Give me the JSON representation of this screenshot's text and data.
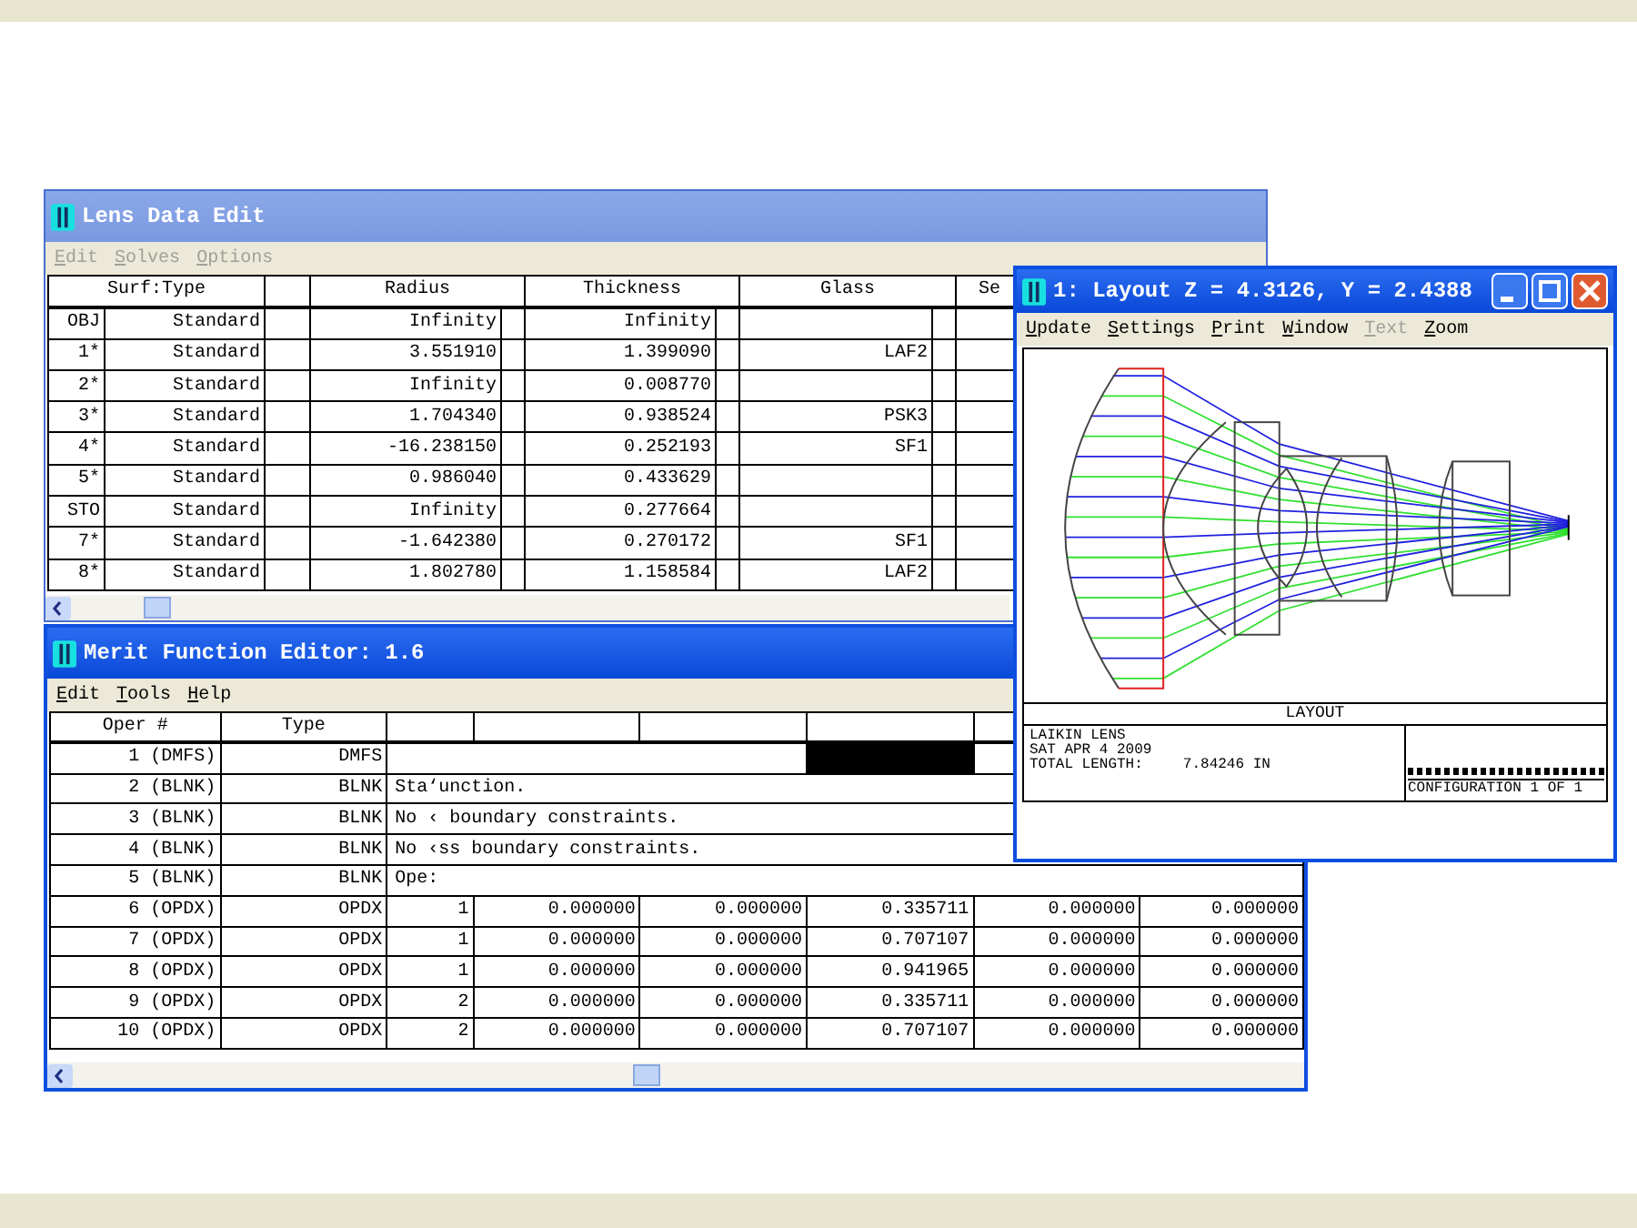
{
  "lens_window": {
    "title": "Lens Data Edit",
    "active": false,
    "menu": [
      {
        "label": "Edit",
        "disabled": true
      },
      {
        "label": "Solves",
        "disabled": true
      },
      {
        "label": "Options",
        "disabled": true
      }
    ],
    "columns": [
      "Surf:Type",
      "Radius",
      "Thickness",
      "Glass",
      "Se"
    ],
    "rows": [
      {
        "surf": "OBJ",
        "type": "Standard",
        "radius": "Infinity",
        "thickness": "Infinity"
      },
      {
        "surf": "1*",
        "type": "Standard",
        "radius": "3.551910",
        "thickness": "1.399090",
        "glass": "LAF2"
      },
      {
        "surf": "2*",
        "type": "Standard",
        "radius": "Infinity",
        "thickness": "0.008770"
      },
      {
        "surf": "3*",
        "type": "Standard",
        "radius": "1.704340",
        "thickness": "0.938524",
        "glass": "PSK3"
      },
      {
        "surf": "4*",
        "type": "Standard",
        "radius": "-16.238150",
        "thickness": "0.252193",
        "glass": "SF1"
      },
      {
        "surf": "5*",
        "type": "Standard",
        "radius": "0.986040",
        "thickness": "0.433629"
      },
      {
        "surf": "STO",
        "type": "Standard",
        "radius": "Infinity",
        "thickness": "0.277664"
      },
      {
        "surf": "7*",
        "type": "Standard",
        "radius": "-1.642380",
        "thickness": "0.270172",
        "glass": "SF1"
      },
      {
        "surf": "8*",
        "type": "Standard",
        "radius": "1.802780",
        "thickness": "1.158584",
        "glass": "LAF2"
      }
    ]
  },
  "merit_window": {
    "title": "Merit Function Editor: 1.6",
    "active": true,
    "menu": [
      {
        "label": "Edit",
        "disabled": false
      },
      {
        "label": "Tools",
        "disabled": false
      },
      {
        "label": "Help",
        "disabled": false
      }
    ],
    "columns": [
      "Oper #",
      "Type"
    ],
    "rows": [
      {
        "kind": "target",
        "oper": "1 (DMFS)",
        "type": "DMFS"
      },
      {
        "kind": "comment",
        "oper": "2 (BLNK)",
        "type": "BLNK",
        "comment": "Sta‘unction."
      },
      {
        "kind": "comment",
        "oper": "3 (BLNK)",
        "type": "BLNK",
        "comment": "No ‹ boundary constraints."
      },
      {
        "kind": "comment",
        "oper": "4 (BLNK)",
        "type": "BLNK",
        "comment": "No ‹ss boundary constraints."
      },
      {
        "kind": "comment",
        "oper": "5 (BLNK)",
        "type": "BLNK",
        "comment": "Ope:"
      },
      {
        "kind": "operand",
        "oper": "6 (OPDX)",
        "type": "OPDX",
        "cells": [
          "1",
          "0.000000",
          "0.000000",
          "0.335711",
          "0.000000",
          "0.000000"
        ]
      },
      {
        "kind": "operand",
        "oper": "7 (OPDX)",
        "type": "OPDX",
        "cells": [
          "1",
          "0.000000",
          "0.000000",
          "0.707107",
          "0.000000",
          "0.000000"
        ]
      },
      {
        "kind": "operand",
        "oper": "8 (OPDX)",
        "type": "OPDX",
        "cells": [
          "1",
          "0.000000",
          "0.000000",
          "0.941965",
          "0.000000",
          "0.000000"
        ]
      },
      {
        "kind": "operand",
        "oper": "9 (OPDX)",
        "type": "OPDX",
        "cells": [
          "2",
          "0.000000",
          "0.000000",
          "0.335711",
          "0.000000",
          "0.000000"
        ]
      },
      {
        "kind": "operand",
        "oper": "10 (OPDX)",
        "type": "OPDX",
        "cells": [
          "2",
          "0.000000",
          "0.000000",
          "0.707107",
          "0.000000",
          "0.000000"
        ]
      }
    ]
  },
  "layout_window": {
    "title": "1: Layout Z = 4.3126, Y = 2.4388",
    "active": true,
    "menu": [
      {
        "label": "Update",
        "disabled": false
      },
      {
        "label": "Settings",
        "disabled": false
      },
      {
        "label": "Print",
        "disabled": false
      },
      {
        "label": "Window",
        "disabled": false
      },
      {
        "label": "Text",
        "disabled": true
      },
      {
        "label": "Zoom",
        "disabled": false
      }
    ],
    "plot_title": "LAYOUT",
    "lens_name": "LAIKIN LENS",
    "date": "SAT APR 4 2009",
    "length_label": "TOTAL LENGTH:",
    "length_value": "7.84246 IN",
    "configuration": "CONFIGURATION 1 OF 1"
  }
}
